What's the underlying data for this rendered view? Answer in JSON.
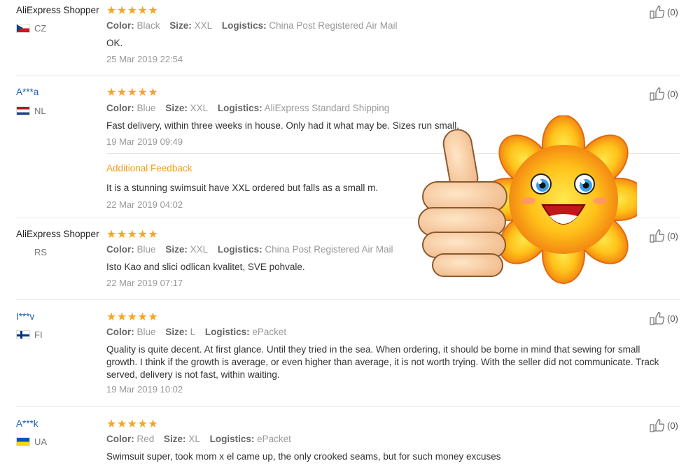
{
  "stars": "★★★★★",
  "helpful_count": "(0)",
  "labels": {
    "color": "Color:",
    "size": "Size:",
    "logistics": "Logistics:",
    "additional": "Additional Feedback"
  },
  "reviews": [
    {
      "name": "AliExpress Shopper",
      "country": "CZ",
      "flag": "cz",
      "color": "Black",
      "size": "XXL",
      "logistics": "China Post Registered Air Mail",
      "text": "OK.",
      "date": "25 Mar 2019 22:54"
    },
    {
      "name": "A***a",
      "country": "NL",
      "flag": "nl",
      "color": "Blue",
      "size": "XXL",
      "logistics": "AliExpress Standard Shipping",
      "text": "Fast delivery, within three weeks in house. Only had it what may be. Sizes run small.",
      "date": "19 Mar 2019 09:49",
      "additional": {
        "text": "It is a stunning swimsuit have XXL ordered but falls as a small m.",
        "date": "22 Mar 2019 04:02"
      }
    },
    {
      "name": "AliExpress Shopper",
      "country": "RS",
      "flag": "",
      "color": "Blue",
      "size": "XXL",
      "logistics": "China Post Registered Air Mail",
      "text": "Isto Kao and slici odlican kvalitet, SVE pohvale.",
      "date": "22 Mar 2019 07:17"
    },
    {
      "name": "I***v",
      "country": "FI",
      "flag": "fi",
      "color": "Blue",
      "size": "L",
      "logistics": "ePacket",
      "text": "Quality is quite decent. At first glance. Until they tried in the sea. When ordering, it should be borne in mind that sewing for small growth. I think if the growth is average, or even higher than average, it is not worth trying. With the seller did not communicate. Track served, delivery is not fast, within waiting.",
      "date": "19 Mar 2019 10:02"
    },
    {
      "name": "A***k",
      "country": "UA",
      "flag": "ua",
      "color": "Red",
      "size": "XL",
      "logistics": "ePacket",
      "text": "Swimsuit super, took mom x el came up, the only crooked seams, but for such money excuses",
      "date": ""
    }
  ],
  "colors": {
    "star": "#f5a623",
    "accent_orange": "#f39c12",
    "name_blue": "#1a5fb4"
  },
  "sticker": "thumbs-up-smiling-flower"
}
